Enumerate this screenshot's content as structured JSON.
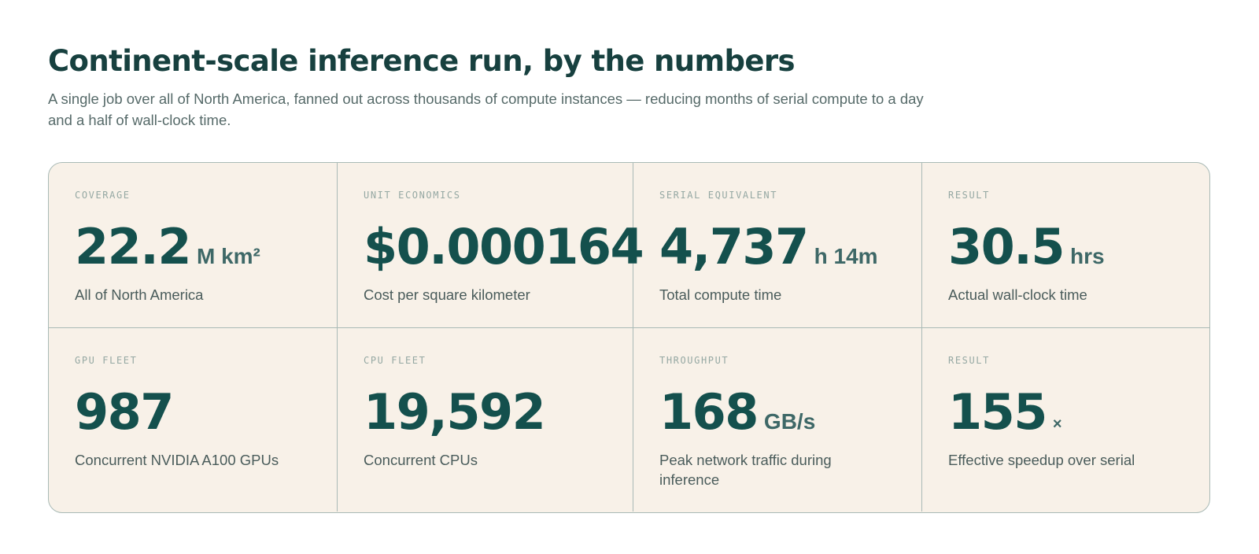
{
  "header": {
    "title": "Continent-scale inference run, by the numbers",
    "subtitle": "A single job over all of North America, fanned out across thousands of compute instances — reducing months of serial compute to a day and a half of wall-clock time."
  },
  "stats": [
    {
      "label": "COVERAGE",
      "value": "22.2",
      "unit": "M km²",
      "description": "All of North America"
    },
    {
      "label": "UNIT ECONOMICS",
      "value": "$0.000164",
      "unit": "",
      "description": "Cost per square kilometer"
    },
    {
      "label": "SERIAL EQUIVALENT",
      "value": "4,737",
      "unit": "h 14m",
      "description": "Total compute time"
    },
    {
      "label": "RESULT",
      "value": "30.5",
      "unit": "hrs",
      "description": "Actual wall-clock time"
    },
    {
      "label": "GPU FLEET",
      "value": "987",
      "unit": "",
      "description": "Concurrent NVIDIA A100 GPUs"
    },
    {
      "label": "CPU FLEET",
      "value": "19,592",
      "unit": "",
      "description": "Concurrent CPUs"
    },
    {
      "label": "THROUGHPUT",
      "value": "168",
      "unit": "GB/s",
      "description": "Peak network traffic during inference"
    },
    {
      "label": "RESULT",
      "value": "155",
      "unit": "×",
      "description": "Effective speedup over serial"
    }
  ],
  "colors": {
    "card_background": "#f8f1e8",
    "border": "#a9bab6",
    "value_text": "#14504d",
    "title_text": "#17403f"
  }
}
